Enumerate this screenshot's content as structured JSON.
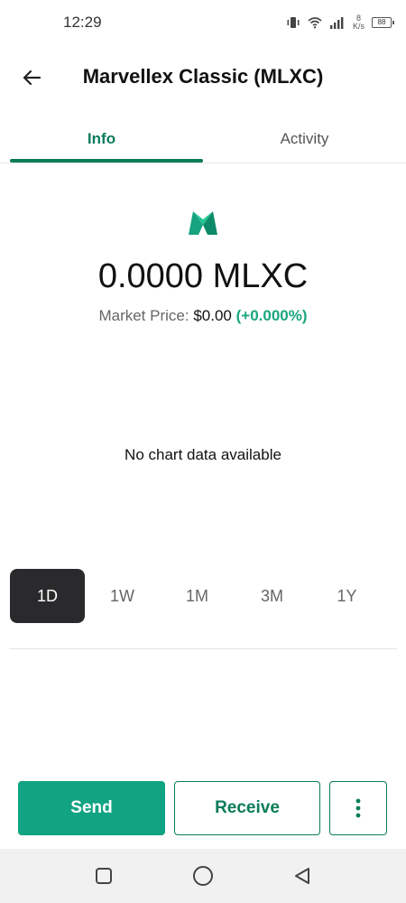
{
  "status_bar": {
    "time": "12:29",
    "net_speed_value": "8",
    "net_speed_unit": "K/s",
    "battery": "88"
  },
  "header": {
    "title": "Marvellex Classic (MLXC)",
    "back_icon": "arrow-left-icon"
  },
  "tabs": [
    {
      "label": "Info",
      "active": true
    },
    {
      "label": "Activity",
      "active": false
    }
  ],
  "token": {
    "logo_icon": "marvellex-m-logo",
    "balance": "0.0000 MLXC",
    "market_price_label": "Market Price:",
    "market_price_value": "$0.00",
    "market_price_change": "(+0.000%)"
  },
  "chart": {
    "empty_message": "No chart data available"
  },
  "ranges": [
    {
      "label": "1D",
      "active": true
    },
    {
      "label": "1W",
      "active": false
    },
    {
      "label": "1M",
      "active": false
    },
    {
      "label": "3M",
      "active": false
    },
    {
      "label": "1Y",
      "active": false
    }
  ],
  "actions": {
    "send_label": "Send",
    "receive_label": "Receive",
    "more_icon": "more-vertical-icon"
  },
  "colors": {
    "brand_green": "#0a7c5a",
    "send_bg": "#12a383",
    "positive_change": "#1aa67f",
    "active_range_bg": "#2a2a2c"
  }
}
